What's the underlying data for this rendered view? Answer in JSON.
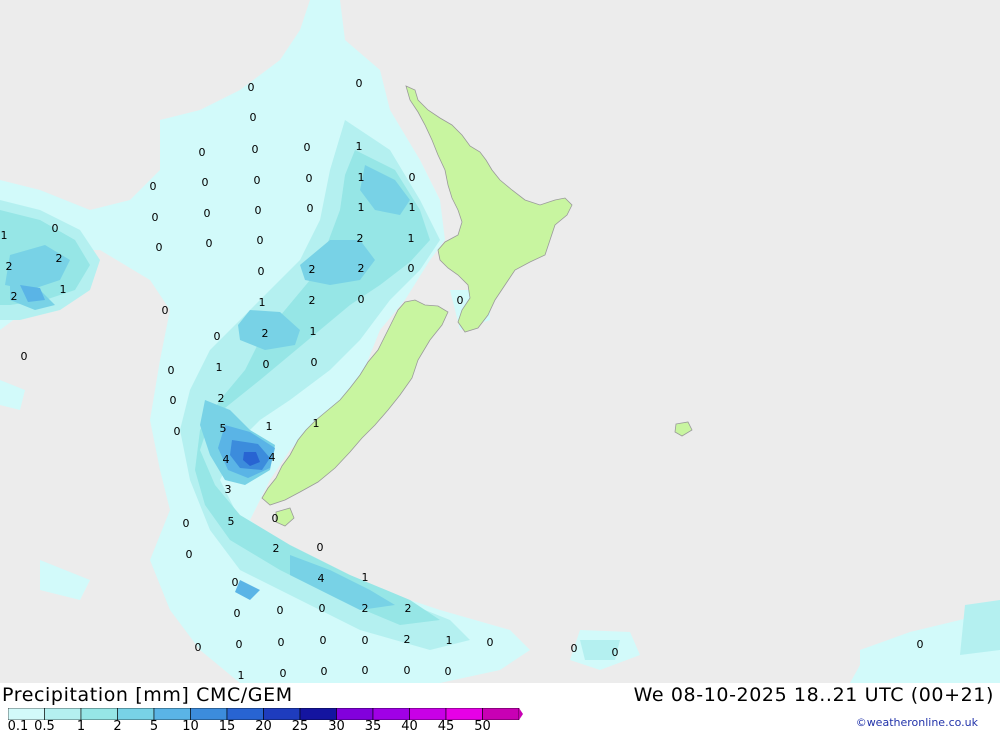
{
  "title": "Precipitation [mm] CMC/GEM",
  "valid_time": "We 08-10-2025 18..21 UTC (00+21)",
  "credit": "©weatheronline.co.uk",
  "colors": {
    "ocean": "#ececec",
    "land": "#c8f5a0",
    "coast": "#9a9a9a"
  },
  "legend": {
    "labels": [
      "0.1",
      "0.5",
      "1",
      "2",
      "5",
      "10",
      "15",
      "20",
      "25",
      "30",
      "35",
      "40",
      "45",
      "50"
    ],
    "colors": [
      "#d2fafa",
      "#b4f0f0",
      "#96e6e6",
      "#78d2e6",
      "#5ab4e6",
      "#3c8cdc",
      "#2864d2",
      "#1e3cbe",
      "#1414a0",
      "#8200dc",
      "#a000e6",
      "#c800e6",
      "#e600e6",
      "#c800b4"
    ]
  },
  "map_values": [
    {
      "id": "v01",
      "t": "0"
    },
    {
      "id": "v02",
      "t": "0"
    },
    {
      "id": "v03",
      "t": "0"
    },
    {
      "id": "v04",
      "t": "0"
    },
    {
      "id": "v05",
      "t": "0"
    },
    {
      "id": "v06",
      "t": "0"
    },
    {
      "id": "v07",
      "t": "1"
    },
    {
      "id": "v08",
      "t": "0"
    },
    {
      "id": "v09",
      "t": "0"
    },
    {
      "id": "v10",
      "t": "0"
    },
    {
      "id": "v11",
      "t": "0"
    },
    {
      "id": "v12",
      "t": "1"
    },
    {
      "id": "v13",
      "t": "0"
    },
    {
      "id": "v14",
      "t": "0"
    },
    {
      "id": "v15",
      "t": "0"
    },
    {
      "id": "v16",
      "t": "0"
    },
    {
      "id": "v17",
      "t": "0"
    },
    {
      "id": "v18",
      "t": "1"
    },
    {
      "id": "v19",
      "t": "1"
    },
    {
      "id": "v20",
      "t": "1"
    },
    {
      "id": "v21",
      "t": "0"
    },
    {
      "id": "v22",
      "t": "0"
    },
    {
      "id": "v23",
      "t": "0"
    },
    {
      "id": "v24",
      "t": "0"
    },
    {
      "id": "v25",
      "t": "2"
    },
    {
      "id": "v26",
      "t": "1"
    },
    {
      "id": "v27",
      "t": "2"
    },
    {
      "id": "v28",
      "t": "2"
    },
    {
      "id": "v29",
      "t": "0"
    },
    {
      "id": "v30",
      "t": "2"
    },
    {
      "id": "v31",
      "t": "2"
    },
    {
      "id": "v32",
      "t": "0"
    },
    {
      "id": "v33",
      "t": "2"
    },
    {
      "id": "v34",
      "t": "1"
    },
    {
      "id": "v35",
      "t": "1"
    },
    {
      "id": "v36",
      "t": "2"
    },
    {
      "id": "v37",
      "t": "0"
    },
    {
      "id": "v38",
      "t": "0"
    },
    {
      "id": "v39",
      "t": "0"
    },
    {
      "id": "v40",
      "t": "0"
    },
    {
      "id": "v41",
      "t": "2"
    },
    {
      "id": "v42",
      "t": "1"
    },
    {
      "id": "v43",
      "t": "0"
    },
    {
      "id": "v44",
      "t": "0"
    },
    {
      "id": "v45",
      "t": "1"
    },
    {
      "id": "v46",
      "t": "0"
    },
    {
      "id": "v47",
      "t": "0"
    },
    {
      "id": "v48",
      "t": "2"
    },
    {
      "id": "v49",
      "t": "0"
    },
    {
      "id": "v50",
      "t": "5"
    },
    {
      "id": "v51",
      "t": "1"
    },
    {
      "id": "v52",
      "t": "1"
    },
    {
      "id": "v53",
      "t": "4"
    },
    {
      "id": "v54",
      "t": "4"
    },
    {
      "id": "v55",
      "t": "3"
    },
    {
      "id": "v56",
      "t": "0"
    },
    {
      "id": "v57",
      "t": "5"
    },
    {
      "id": "v58",
      "t": "0"
    },
    {
      "id": "v59",
      "t": "0"
    },
    {
      "id": "v60",
      "t": "2"
    },
    {
      "id": "v61",
      "t": "0"
    },
    {
      "id": "v62",
      "t": "0"
    },
    {
      "id": "v63",
      "t": "4"
    },
    {
      "id": "v64",
      "t": "1"
    },
    {
      "id": "v65",
      "t": "0"
    },
    {
      "id": "v66",
      "t": "0"
    },
    {
      "id": "v67",
      "t": "0"
    },
    {
      "id": "v68",
      "t": "2"
    },
    {
      "id": "v69",
      "t": "2"
    },
    {
      "id": "v70",
      "t": "0"
    },
    {
      "id": "v71",
      "t": "0"
    },
    {
      "id": "v72",
      "t": "0"
    },
    {
      "id": "v73",
      "t": "0"
    },
    {
      "id": "v74",
      "t": "2"
    },
    {
      "id": "v75",
      "t": "1"
    },
    {
      "id": "v76",
      "t": "0"
    },
    {
      "id": "v77",
      "t": "0"
    },
    {
      "id": "v78",
      "t": "0"
    },
    {
      "id": "v79",
      "t": "1"
    },
    {
      "id": "v80",
      "t": "0"
    },
    {
      "id": "v81",
      "t": "0"
    },
    {
      "id": "v82",
      "t": "0"
    },
    {
      "id": "v83",
      "t": "0"
    },
    {
      "id": "v84",
      "t": "0"
    },
    {
      "id": "v85",
      "t": "0"
    },
    {
      "id": "v86",
      "t": "0"
    },
    {
      "id": "v87",
      "t": "0"
    }
  ]
}
